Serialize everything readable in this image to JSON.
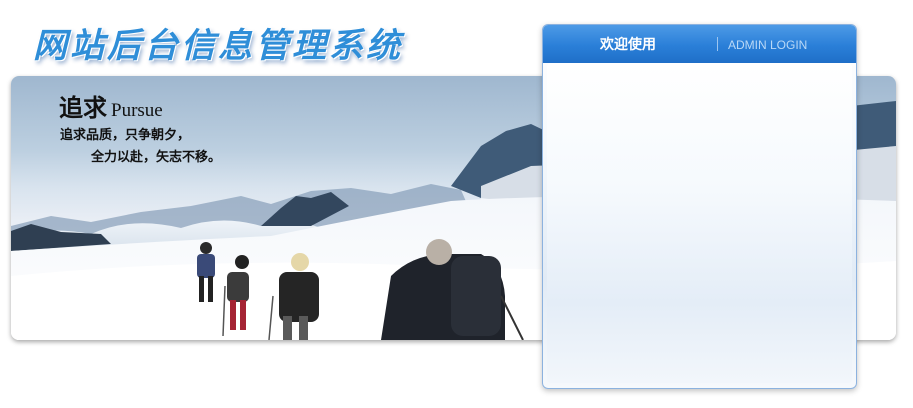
{
  "header": {
    "title": "网站后台信息管理系统"
  },
  "banner": {
    "slogan_cn": "追求",
    "slogan_en": "Pursue",
    "line1": "追求品质，只争朝夕，",
    "line2": "全力以赴，矢志不移。"
  },
  "login": {
    "tab_welcome": "欢迎使用",
    "tab_admin": "ADMIN LOGIN"
  },
  "colors": {
    "title_blue": "#2f8ed8",
    "header_blue": "#2a7fd8",
    "panel_border": "#8cb2df"
  }
}
